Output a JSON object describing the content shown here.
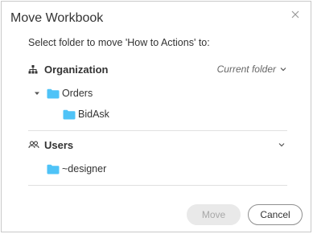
{
  "dialog": {
    "title": "Move Workbook",
    "instruction": "Select folder to move 'How to Actions' to:",
    "close_icon": "close-icon"
  },
  "organization": {
    "label": "Organization",
    "icon": "org-hierarchy-icon",
    "current_folder_label": "Current folder",
    "tree": [
      {
        "label": "Orders",
        "expanded": true,
        "icon": "folder-icon"
      },
      {
        "label": "BidAsk",
        "icon": "folder-icon"
      }
    ]
  },
  "users": {
    "label": "Users",
    "icon": "users-icon",
    "tree": [
      {
        "label": "~designer",
        "icon": "folder-icon"
      }
    ]
  },
  "buttons": {
    "move": "Move",
    "cancel": "Cancel"
  },
  "colors": {
    "folder": "#4fc3f7",
    "border": "#c9c9c9",
    "disabled_button": "#e9e9e9"
  }
}
